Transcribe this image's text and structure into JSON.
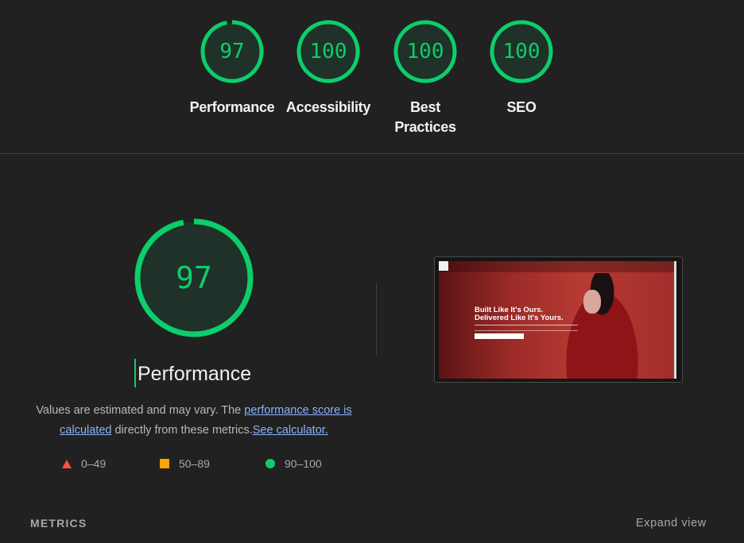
{
  "summary_gauges": [
    {
      "score": "97",
      "label": "Performance"
    },
    {
      "score": "100",
      "label": "Accessibility"
    },
    {
      "score": "100",
      "label": "Best Practices"
    },
    {
      "score": "100",
      "label": "SEO"
    }
  ],
  "performance": {
    "score": "97",
    "score_fraction": 0.97,
    "title": "Performance",
    "desc_1": "Values are estimated and may vary. The ",
    "desc_link_1": "performance score is calculated",
    "desc_2": " directly from these metrics.",
    "desc_link_2": "See calculator."
  },
  "legend": [
    {
      "icon": "red-triangle-icon",
      "range": "0–49"
    },
    {
      "icon": "orange-square-icon",
      "range": "50–89"
    },
    {
      "icon": "green-circle-icon",
      "range": "90–100"
    }
  ],
  "screenshot": {
    "hero_title_1": "Built Like It's Ours.",
    "hero_title_2": "Delivered Like It's Yours."
  },
  "metrics": {
    "label": "METRICS",
    "expand_label": "Expand view"
  },
  "colors": {
    "pass": "#0cce6b",
    "average": "#ffa400",
    "fail": "#ff4e42",
    "background": "#212121"
  }
}
